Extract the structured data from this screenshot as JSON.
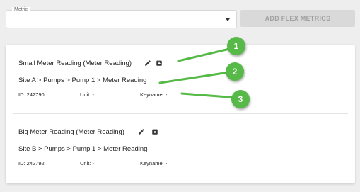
{
  "metric_select": {
    "label": "Metric",
    "value": ""
  },
  "add_button": {
    "label": "ADD FLEX METRICS"
  },
  "items": [
    {
      "title": "Small Meter Reading (Meter Reading)",
      "path": "Site A > Pumps > Pump 1 > Meter Reading",
      "id": "ID: 242790",
      "unit": "Unit: -",
      "keyname": "Keyname: -"
    },
    {
      "title": "Big Meter Reading (Meter Reading)",
      "path": "Site B > Pumps > Pump 1 > Meter Reading",
      "id": "ID: 242792",
      "unit": "Unit: -",
      "keyname": "Keyname: -"
    }
  ],
  "callouts": [
    "1",
    "2",
    "3"
  ],
  "colors": {
    "callout_green": "#57b947",
    "button_disabled": "#d9d9d9"
  },
  "icons": [
    "chevron-down-icon",
    "pencil-icon",
    "archive-icon"
  ]
}
